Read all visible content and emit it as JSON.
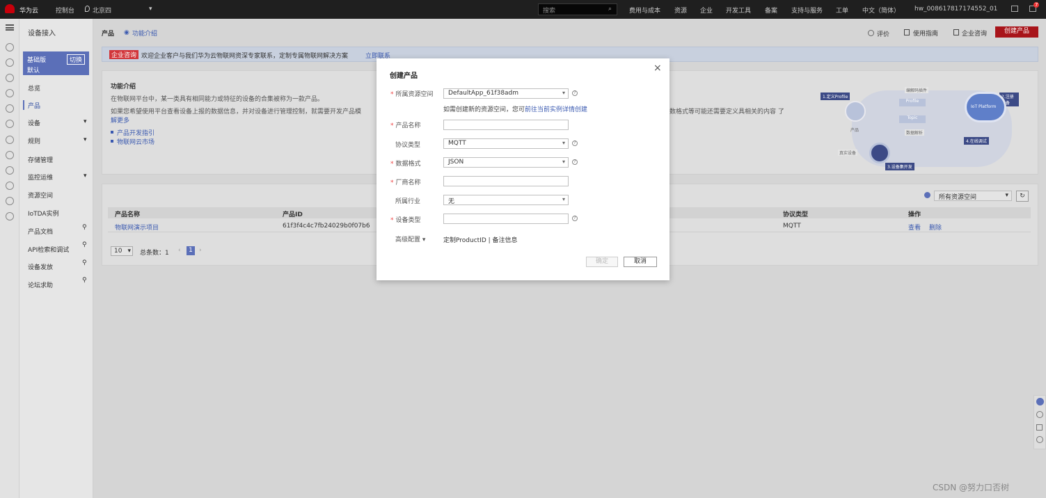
{
  "topbar": {
    "brand": "华为云",
    "console": "控制台",
    "region": "北京四",
    "search_placeholder": "搜索",
    "nav": [
      "费用与成本",
      "资源",
      "企业",
      "开发工具",
      "备案",
      "支持与服务",
      "工单",
      "中文（简体）"
    ],
    "user": "hw_008617817174552_01",
    "badge": "7"
  },
  "sidebar": {
    "title": "设备接入",
    "edition_label": "基础版",
    "edition_sub": "默认",
    "switch_label": "切换",
    "items": [
      {
        "label": "总览"
      },
      {
        "label": "产品"
      },
      {
        "label": "设备"
      },
      {
        "label": "规则"
      },
      {
        "label": "存储管理"
      },
      {
        "label": "监控运维"
      },
      {
        "label": "资源空间"
      },
      {
        "label": "IoTDA实例"
      },
      {
        "label": "产品文档"
      },
      {
        "label": "API检索和调试"
      },
      {
        "label": "设备发放"
      },
      {
        "label": "论坛求助"
      }
    ]
  },
  "header": {
    "title": "产品",
    "intro_link": "功能介绍",
    "actions": {
      "rate": "评价",
      "guide": "使用指南",
      "consult": "企业咨询",
      "create": "创建产品"
    }
  },
  "banner": {
    "tag": "企业咨询",
    "text": "欢迎企业客户与我们华为云物联网资深专家联系，定制专属物联网解决方案",
    "link": "立即联系"
  },
  "intro": {
    "title": "功能介绍",
    "p1": "在物联网平台中，某一类具有相同能力或特征的设备的合集被称为一款产品。",
    "p2": "如果您希望使用平台查看设备上报的数据信息，并对设备进行管理控制，就需要开发产品模",
    "p2_tail": "数格式等可能还需要定义具相关的内容 了",
    "more": "解更多",
    "links": [
      "产品开发指引",
      "物联网云市场"
    ],
    "diagram": {
      "step1": "1.定义Profile",
      "step2": "2.注册设备",
      "step3": "3.设备集开发",
      "step4": "4.在线调试",
      "center": "IoT Platform",
      "codec": "编解码插件",
      "profile": "Profile",
      "topic": "Topic",
      "product": "产品",
      "real_device": "真实设备",
      "data_parse": "数据解析"
    }
  },
  "table": {
    "space_select": "所有资源空间",
    "headers": [
      "产品名称",
      "产品ID",
      "协议类型",
      "操作"
    ],
    "rows": [
      {
        "name": "物联网演示项目",
        "id": "61f3f4c4c7fb24029b0f07b6",
        "protocol": "MQTT",
        "view": "查看",
        "delete": "删除"
      }
    ],
    "page_size": "10",
    "total": "总条数：1",
    "page": "1"
  },
  "dialog": {
    "title": "创建产品",
    "fields": {
      "space_label": "所属资源空间",
      "space_value": "DefaultApp_61f38adm",
      "space_hint": "如需创建新的资源空间，您可",
      "space_hint_link": "前往当前实例详情创建",
      "name_label": "产品名称",
      "name_value": "",
      "protocol_label": "协议类型",
      "protocol_value": "MQTT",
      "format_label": "数据格式",
      "format_value": "JSON",
      "vendor_label": "厂商名称",
      "vendor_value": "",
      "industry_label": "所属行业",
      "industry_value": "无",
      "devtype_label": "设备类型",
      "devtype_value": "",
      "advanced_label": "高级配置",
      "advanced_value": "定制ProductID | 备注信息"
    },
    "ok": "确定",
    "cancel": "取消"
  },
  "watermark": "CSDN @努力口否树"
}
